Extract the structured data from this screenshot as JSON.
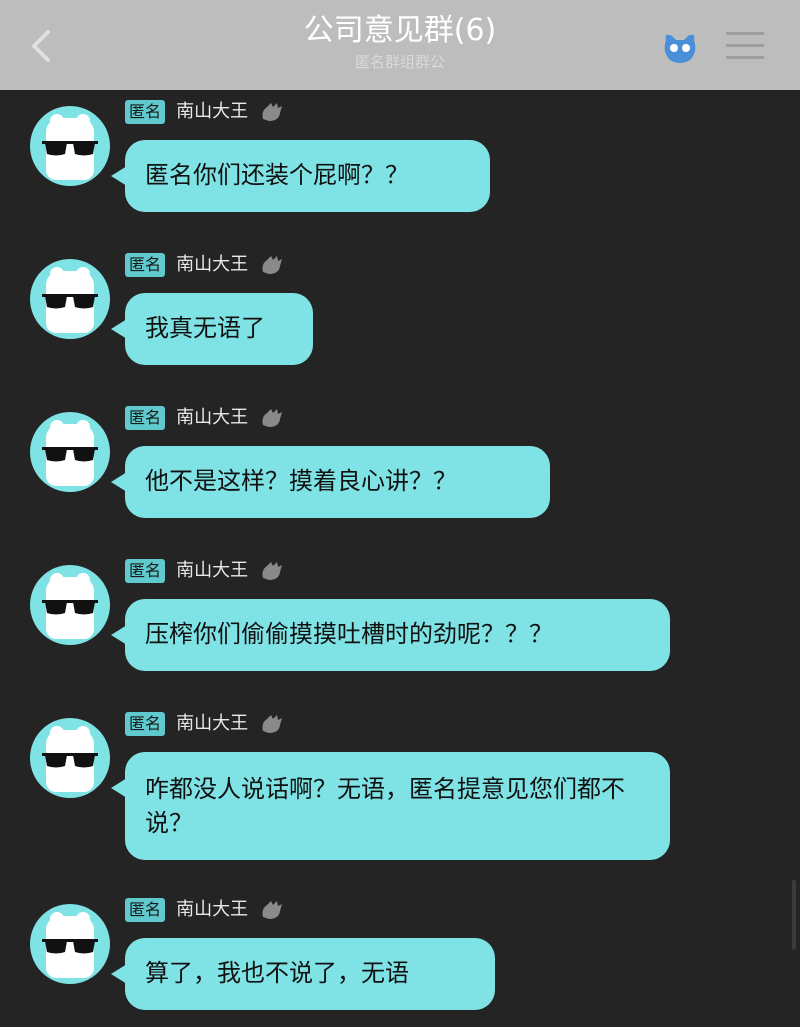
{
  "header": {
    "title": "公司意见群(6)",
    "subtitle": "匿名群组群公",
    "back_icon": "chevron-left-icon",
    "anon_icon": "anonymous-mask-icon",
    "menu_icon": "menu-icon"
  },
  "messages": [
    {
      "badge": "匿名",
      "sender": "南山大王",
      "text": "匿名你们还装个屁啊？？"
    },
    {
      "badge": "匿名",
      "sender": "南山大王",
      "text": "我真无语了"
    },
    {
      "badge": "匿名",
      "sender": "南山大王",
      "text": "他不是这样？摸着良心讲？？"
    },
    {
      "badge": "匿名",
      "sender": "南山大王",
      "text": "压榨你们偷偷摸摸吐槽时的劲呢？？？"
    },
    {
      "badge": "匿名",
      "sender": "南山大王",
      "text": "咋都没人说话啊？无语，匿名提意见您们都不说？"
    },
    {
      "badge": "匿名",
      "sender": "南山大王",
      "text": "算了，我也不说了，无语"
    }
  ],
  "colors": {
    "background": "#242424",
    "header": "#bdbdbd",
    "bubble": "#7fe3e6",
    "badge": "#5fc9cd"
  }
}
